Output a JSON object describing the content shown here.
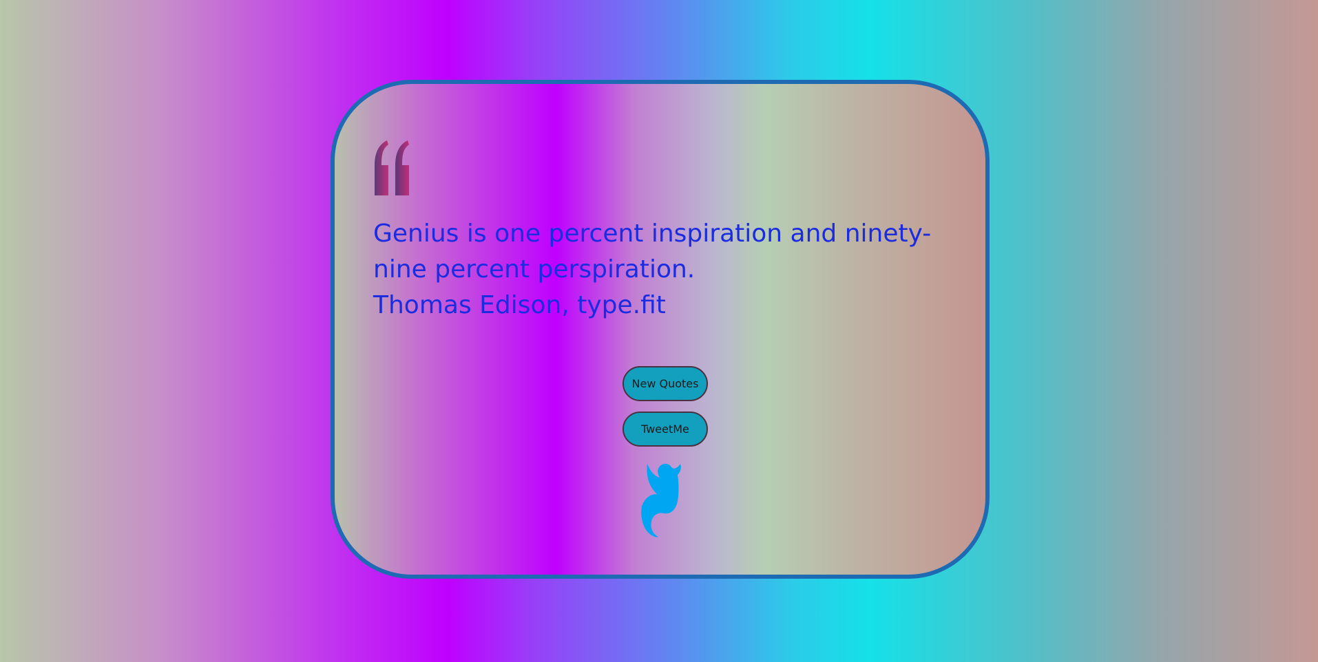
{
  "quote": {
    "text": "Genius is one percent inspiration and ninety-nine percent perspiration.",
    "author": "Thomas Edison, type.fit"
  },
  "buttons": {
    "new_quote": "New Quotes",
    "tweet": "TweetMe"
  },
  "icons": {
    "quote_mark": "left-double-quote-icon",
    "twitter": "twitter-bird-icon"
  },
  "colors": {
    "quote_text": "#1a2be0",
    "card_border": "#1e6bb3",
    "button_bg": "#13a0bf",
    "twitter_blue": "#00a6f2"
  }
}
